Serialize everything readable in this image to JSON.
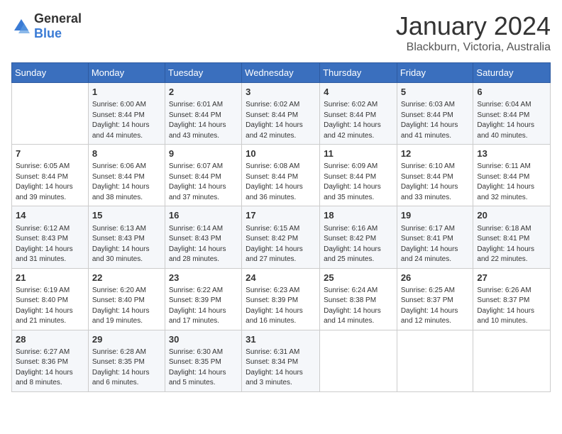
{
  "logo": {
    "general": "General",
    "blue": "Blue"
  },
  "header": {
    "month": "January 2024",
    "location": "Blackburn, Victoria, Australia"
  },
  "weekdays": [
    "Sunday",
    "Monday",
    "Tuesday",
    "Wednesday",
    "Thursday",
    "Friday",
    "Saturday"
  ],
  "weeks": [
    [
      {
        "day": "",
        "sunrise": "",
        "sunset": "",
        "daylight": ""
      },
      {
        "day": "1",
        "sunrise": "Sunrise: 6:00 AM",
        "sunset": "Sunset: 8:44 PM",
        "daylight": "Daylight: 14 hours and 44 minutes."
      },
      {
        "day": "2",
        "sunrise": "Sunrise: 6:01 AM",
        "sunset": "Sunset: 8:44 PM",
        "daylight": "Daylight: 14 hours and 43 minutes."
      },
      {
        "day": "3",
        "sunrise": "Sunrise: 6:02 AM",
        "sunset": "Sunset: 8:44 PM",
        "daylight": "Daylight: 14 hours and 42 minutes."
      },
      {
        "day": "4",
        "sunrise": "Sunrise: 6:02 AM",
        "sunset": "Sunset: 8:44 PM",
        "daylight": "Daylight: 14 hours and 42 minutes."
      },
      {
        "day": "5",
        "sunrise": "Sunrise: 6:03 AM",
        "sunset": "Sunset: 8:44 PM",
        "daylight": "Daylight: 14 hours and 41 minutes."
      },
      {
        "day": "6",
        "sunrise": "Sunrise: 6:04 AM",
        "sunset": "Sunset: 8:44 PM",
        "daylight": "Daylight: 14 hours and 40 minutes."
      }
    ],
    [
      {
        "day": "7",
        "sunrise": "Sunrise: 6:05 AM",
        "sunset": "Sunset: 8:44 PM",
        "daylight": "Daylight: 14 hours and 39 minutes."
      },
      {
        "day": "8",
        "sunrise": "Sunrise: 6:06 AM",
        "sunset": "Sunset: 8:44 PM",
        "daylight": "Daylight: 14 hours and 38 minutes."
      },
      {
        "day": "9",
        "sunrise": "Sunrise: 6:07 AM",
        "sunset": "Sunset: 8:44 PM",
        "daylight": "Daylight: 14 hours and 37 minutes."
      },
      {
        "day": "10",
        "sunrise": "Sunrise: 6:08 AM",
        "sunset": "Sunset: 8:44 PM",
        "daylight": "Daylight: 14 hours and 36 minutes."
      },
      {
        "day": "11",
        "sunrise": "Sunrise: 6:09 AM",
        "sunset": "Sunset: 8:44 PM",
        "daylight": "Daylight: 14 hours and 35 minutes."
      },
      {
        "day": "12",
        "sunrise": "Sunrise: 6:10 AM",
        "sunset": "Sunset: 8:44 PM",
        "daylight": "Daylight: 14 hours and 33 minutes."
      },
      {
        "day": "13",
        "sunrise": "Sunrise: 6:11 AM",
        "sunset": "Sunset: 8:44 PM",
        "daylight": "Daylight: 14 hours and 32 minutes."
      }
    ],
    [
      {
        "day": "14",
        "sunrise": "Sunrise: 6:12 AM",
        "sunset": "Sunset: 8:43 PM",
        "daylight": "Daylight: 14 hours and 31 minutes."
      },
      {
        "day": "15",
        "sunrise": "Sunrise: 6:13 AM",
        "sunset": "Sunset: 8:43 PM",
        "daylight": "Daylight: 14 hours and 30 minutes."
      },
      {
        "day": "16",
        "sunrise": "Sunrise: 6:14 AM",
        "sunset": "Sunset: 8:43 PM",
        "daylight": "Daylight: 14 hours and 28 minutes."
      },
      {
        "day": "17",
        "sunrise": "Sunrise: 6:15 AM",
        "sunset": "Sunset: 8:42 PM",
        "daylight": "Daylight: 14 hours and 27 minutes."
      },
      {
        "day": "18",
        "sunrise": "Sunrise: 6:16 AM",
        "sunset": "Sunset: 8:42 PM",
        "daylight": "Daylight: 14 hours and 25 minutes."
      },
      {
        "day": "19",
        "sunrise": "Sunrise: 6:17 AM",
        "sunset": "Sunset: 8:41 PM",
        "daylight": "Daylight: 14 hours and 24 minutes."
      },
      {
        "day": "20",
        "sunrise": "Sunrise: 6:18 AM",
        "sunset": "Sunset: 8:41 PM",
        "daylight": "Daylight: 14 hours and 22 minutes."
      }
    ],
    [
      {
        "day": "21",
        "sunrise": "Sunrise: 6:19 AM",
        "sunset": "Sunset: 8:40 PM",
        "daylight": "Daylight: 14 hours and 21 minutes."
      },
      {
        "day": "22",
        "sunrise": "Sunrise: 6:20 AM",
        "sunset": "Sunset: 8:40 PM",
        "daylight": "Daylight: 14 hours and 19 minutes."
      },
      {
        "day": "23",
        "sunrise": "Sunrise: 6:22 AM",
        "sunset": "Sunset: 8:39 PM",
        "daylight": "Daylight: 14 hours and 17 minutes."
      },
      {
        "day": "24",
        "sunrise": "Sunrise: 6:23 AM",
        "sunset": "Sunset: 8:39 PM",
        "daylight": "Daylight: 14 hours and 16 minutes."
      },
      {
        "day": "25",
        "sunrise": "Sunrise: 6:24 AM",
        "sunset": "Sunset: 8:38 PM",
        "daylight": "Daylight: 14 hours and 14 minutes."
      },
      {
        "day": "26",
        "sunrise": "Sunrise: 6:25 AM",
        "sunset": "Sunset: 8:37 PM",
        "daylight": "Daylight: 14 hours and 12 minutes."
      },
      {
        "day": "27",
        "sunrise": "Sunrise: 6:26 AM",
        "sunset": "Sunset: 8:37 PM",
        "daylight": "Daylight: 14 hours and 10 minutes."
      }
    ],
    [
      {
        "day": "28",
        "sunrise": "Sunrise: 6:27 AM",
        "sunset": "Sunset: 8:36 PM",
        "daylight": "Daylight: 14 hours and 8 minutes."
      },
      {
        "day": "29",
        "sunrise": "Sunrise: 6:28 AM",
        "sunset": "Sunset: 8:35 PM",
        "daylight": "Daylight: 14 hours and 6 minutes."
      },
      {
        "day": "30",
        "sunrise": "Sunrise: 6:30 AM",
        "sunset": "Sunset: 8:35 PM",
        "daylight": "Daylight: 14 hours and 5 minutes."
      },
      {
        "day": "31",
        "sunrise": "Sunrise: 6:31 AM",
        "sunset": "Sunset: 8:34 PM",
        "daylight": "Daylight: 14 hours and 3 minutes."
      },
      {
        "day": "",
        "sunrise": "",
        "sunset": "",
        "daylight": ""
      },
      {
        "day": "",
        "sunrise": "",
        "sunset": "",
        "daylight": ""
      },
      {
        "day": "",
        "sunrise": "",
        "sunset": "",
        "daylight": ""
      }
    ]
  ]
}
